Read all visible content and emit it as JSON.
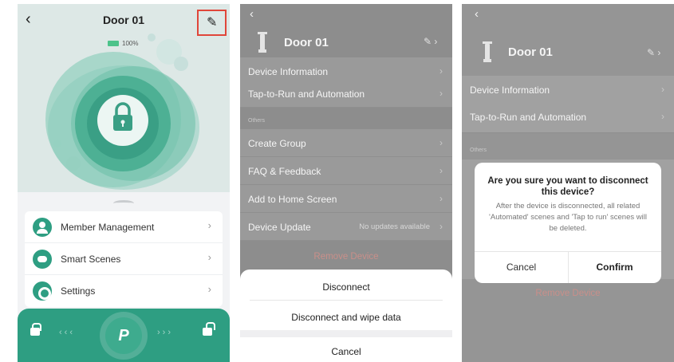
{
  "panel1": {
    "title": "Door 01",
    "battery": "100%",
    "list": [
      {
        "label": "Member Management",
        "icon": "person-icon"
      },
      {
        "label": "Smart Scenes",
        "icon": "scene-icon"
      },
      {
        "label": "Settings",
        "icon": "gear-icon"
      }
    ],
    "unlock_button": "P",
    "colors": {
      "accent": "#2e9e82",
      "highlight": "#e0463a"
    }
  },
  "panel2": {
    "title": "Door 01",
    "rows": [
      {
        "label": "Device Information"
      },
      {
        "label": "Tap-to-Run and Automation"
      }
    ],
    "section": "Others",
    "other_rows": [
      {
        "label": "Create Group"
      },
      {
        "label": "FAQ & Feedback"
      },
      {
        "label": "Add to Home Screen"
      },
      {
        "label": "Device Update",
        "value": "No updates available"
      }
    ],
    "remove": "Remove Device",
    "sheet": {
      "disconnect": "Disconnect",
      "disconnect_wipe": "Disconnect and wipe data",
      "cancel": "Cancel"
    }
  },
  "panel3": {
    "title": "Door 01",
    "rows": [
      {
        "label": "Device Information"
      },
      {
        "label": "Tap-to-Run and Automation"
      }
    ],
    "section": "Others",
    "remove": "Remove Device",
    "dialog": {
      "title": "Are you sure you want to disconnect this device?",
      "body": "After the device is disconnected, all related 'Automated' scenes and 'Tap to run' scenes will be deleted.",
      "cancel": "Cancel",
      "confirm": "Confirm"
    }
  }
}
